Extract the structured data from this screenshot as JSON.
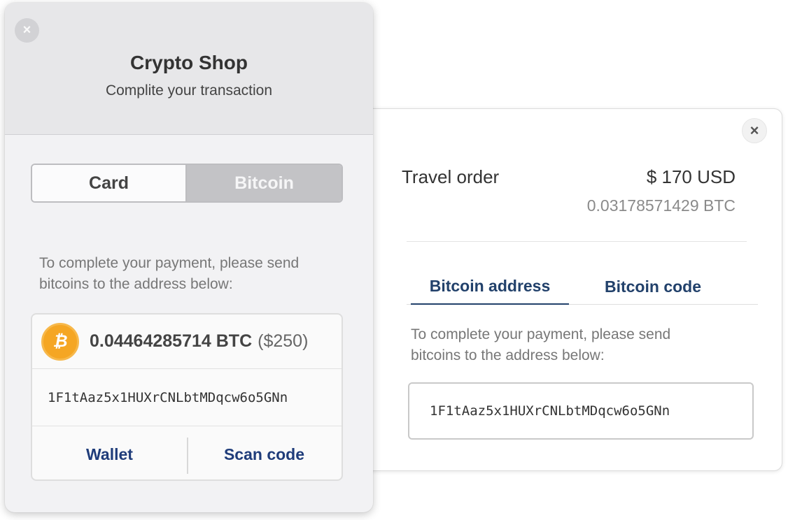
{
  "back_modal": {
    "close_icon": "×",
    "order_title": "Travel order",
    "order_price_usd": "$ 170 USD",
    "order_price_btc": "0.03178571429 BTC",
    "tabs": [
      {
        "label": "Bitcoin address",
        "active": true
      },
      {
        "label": "Bitcoin code",
        "active": false
      }
    ],
    "instructions": "To complete your payment, please send bitcoins to the address below:",
    "address": "1F1tAaz5x1HUXrCNLbtMDqcw6o5GNn"
  },
  "front_modal": {
    "close_icon": "×",
    "title": "Crypto Shop",
    "subtitle": "Complite your transaction",
    "payment_methods": [
      {
        "label": "Card",
        "selected": false
      },
      {
        "label": "Bitcoin",
        "selected": true
      }
    ],
    "instructions": "To complete your payment, please send bitcoins to the address below:",
    "coin_symbol": "₿",
    "amount_btc": "0.04464285714 BTC",
    "amount_usd": "($250)",
    "address": "1F1tAaz5x1HUXrCNLbtMDqcw6o5GNn",
    "actions": [
      {
        "label": "Wallet"
      },
      {
        "label": "Scan code"
      }
    ]
  },
  "colors": {
    "accent_navy": "#1f3c7a",
    "bitcoin_orange": "#f5a623",
    "selected_segment": "#c3c3c6"
  }
}
